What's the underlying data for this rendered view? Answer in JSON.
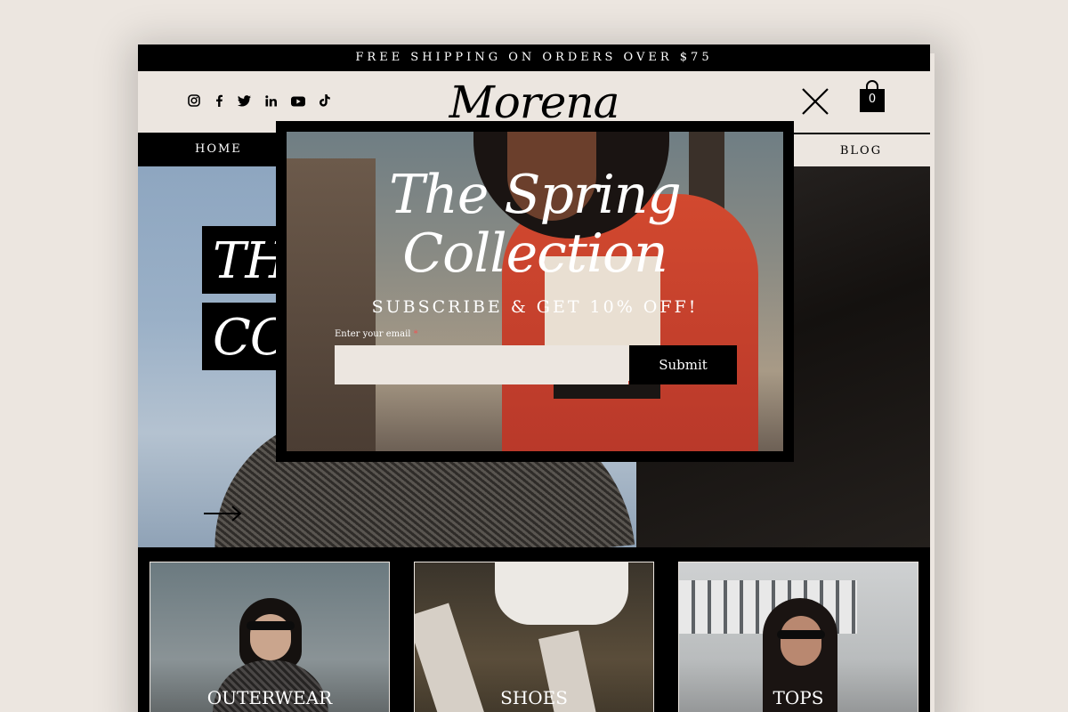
{
  "promo_bar": {
    "text": "FREE SHIPPING ON ORDERS OVER $75"
  },
  "header": {
    "logo": "Morena",
    "social_icons": [
      "instagram-icon",
      "facebook-icon",
      "twitter-icon",
      "linkedin-icon",
      "youtube-icon",
      "tiktok-icon"
    ],
    "cart_count": "0"
  },
  "nav": {
    "home": "HOME",
    "blog": "BLOG"
  },
  "hero": {
    "line1": "THE",
    "line2": "COL"
  },
  "categories": [
    {
      "label": "OUTERWEAR"
    },
    {
      "label": "SHOES"
    },
    {
      "label": "TOPS"
    }
  ],
  "popup": {
    "title_line1": "The Spring",
    "title_line2": "Collection",
    "subtitle": "SUBSCRIBE & GET 10% OFF!",
    "email_label": "Enter your email",
    "required_mark": "*",
    "email_value": "",
    "submit_label": "Submit"
  },
  "colors": {
    "cream": "#ece6e0",
    "black": "#000000",
    "jacket_red": "#d2492f"
  }
}
